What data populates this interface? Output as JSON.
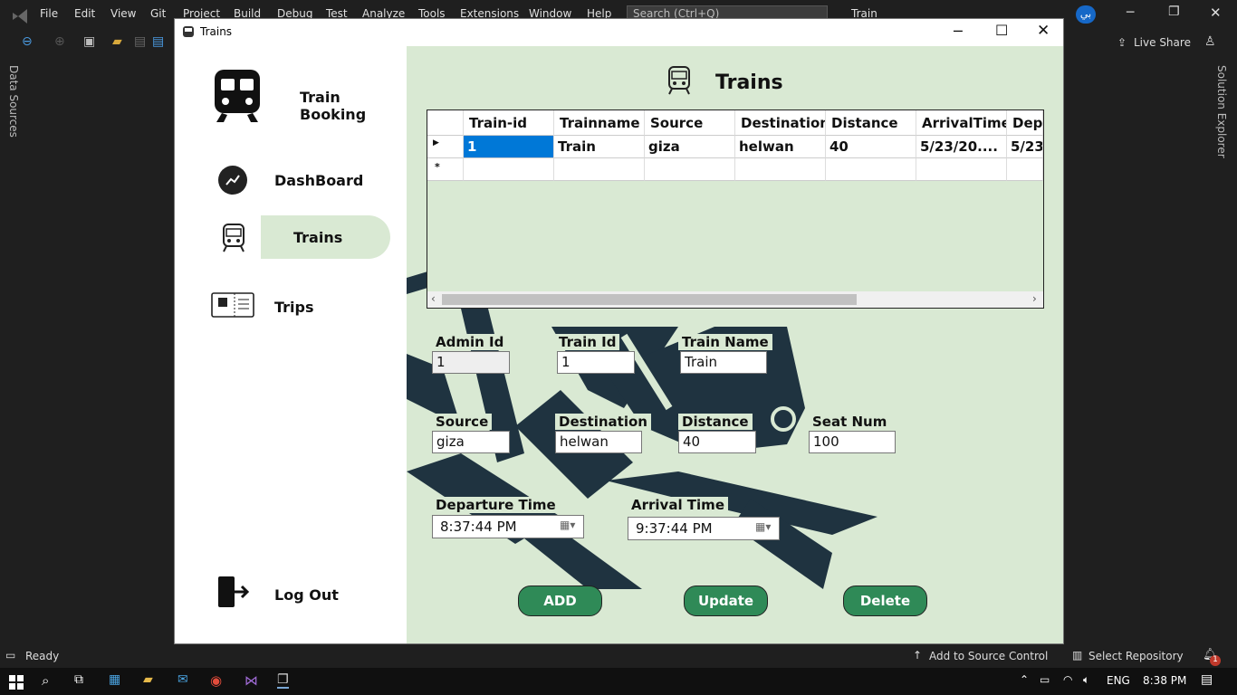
{
  "vs": {
    "menu": [
      "File",
      "Edit",
      "View",
      "Git",
      "Project",
      "Build",
      "Debug",
      "Test",
      "Analyze",
      "Tools",
      "Extensions",
      "Window",
      "Help"
    ],
    "search_placeholder": "Search (Ctrl+Q)",
    "solution_title": "Train",
    "user_badge": "بي",
    "live_share": "Live Share",
    "left_panel": "Data Sources",
    "right_panel": "Solution Explorer"
  },
  "status": {
    "ready": "Ready",
    "add_source": "Add to Source Control",
    "select_repo": "Select Repository",
    "notifications": "1"
  },
  "taskbar": {
    "lang": "ENG",
    "time": "8:38 PM"
  },
  "form": {
    "window_title": "Trains",
    "sidebar": {
      "brand": "Train Booking",
      "items": [
        {
          "label": "DashBoard"
        },
        {
          "label": "Trains"
        },
        {
          "label": "Trips"
        }
      ],
      "logout": "Log Out"
    },
    "header": "Trains",
    "grid": {
      "columns": [
        "Train-id",
        "Trainname",
        "Source",
        "Destination",
        "Distance",
        "ArrivalTime",
        "Dep"
      ],
      "rows": [
        [
          "1",
          "Train",
          "giza",
          "helwan",
          "40",
          "5/23/20....",
          "5/23"
        ]
      ],
      "new_row_marker": "*"
    },
    "fields": {
      "admin_id": {
        "label": "Admin Id",
        "value": "1"
      },
      "train_id": {
        "label": "Train Id",
        "value": "1"
      },
      "train_name": {
        "label": "Train Name",
        "value": "Train"
      },
      "source": {
        "label": "Source",
        "value": "giza"
      },
      "destination": {
        "label": "Destination",
        "value": "helwan"
      },
      "distance": {
        "label": "Distance",
        "value": "40"
      },
      "seat_num": {
        "label": "Seat Num",
        "value": "100"
      },
      "departure_time": {
        "label": "Departure Time",
        "value": "8:37:44 PM"
      },
      "arrival_time": {
        "label": "Arrival Time",
        "value": "9:37:44 PM"
      }
    },
    "buttons": {
      "add": "ADD",
      "update": "Update",
      "delete": "Delete"
    }
  },
  "colors": {
    "content_bg": "#d9e9d3",
    "button_green": "#2f8a57",
    "active_nav": "#d9e9d3"
  }
}
